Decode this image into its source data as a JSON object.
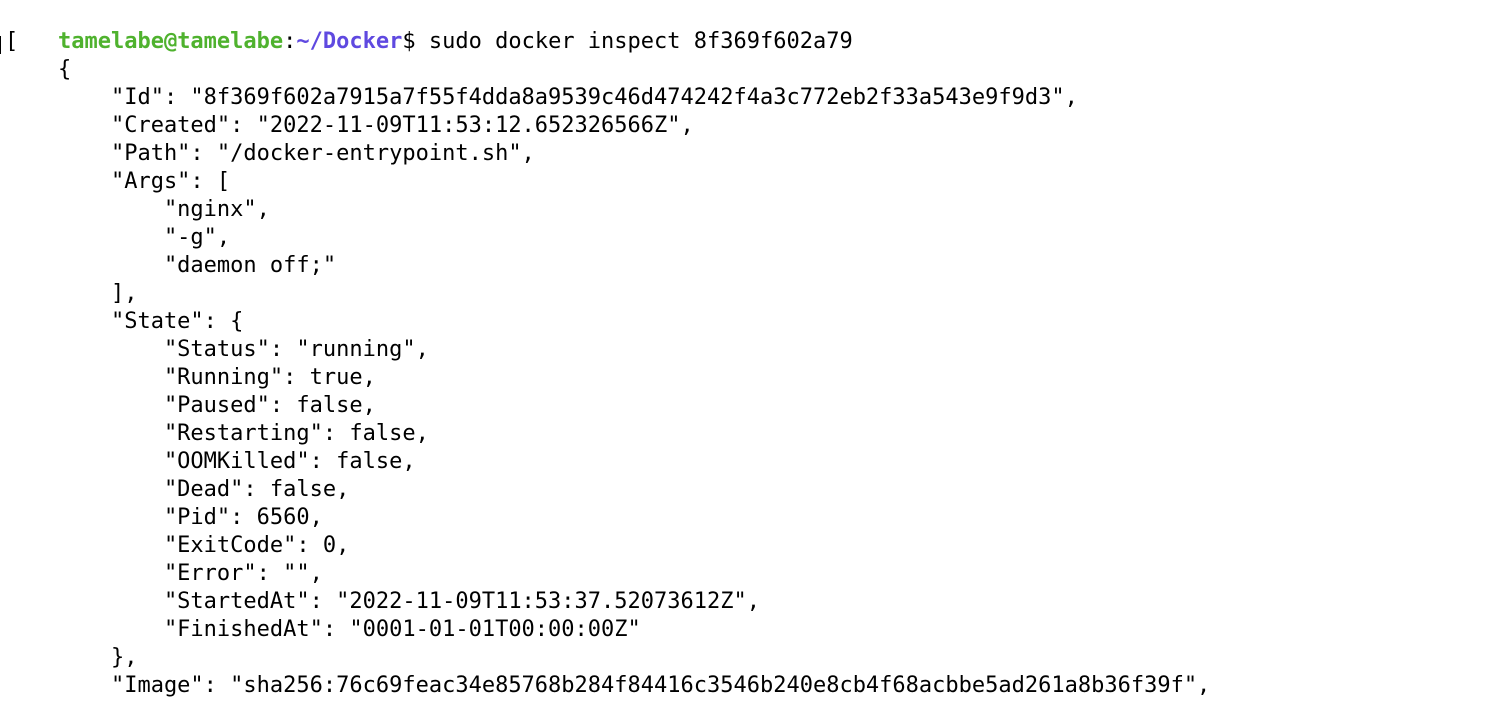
{
  "prompt": {
    "user_host": "tamelabe@tamelabe",
    "colon": ":",
    "path": "~/Docker",
    "dollar": "$",
    "command": " sudo docker inspect 8f369f602a79"
  },
  "colors": {
    "user_host": "#4fb22e",
    "path": "#5f49e0",
    "text": "#000000",
    "background": "#ffffff"
  },
  "output_lines": [
    "[",
    "    {",
    "        \"Id\": \"8f369f602a7915a7f55f4dda8a9539c46d474242f4a3c772eb2f33a543e9f9d3\",",
    "        \"Created\": \"2022-11-09T11:53:12.652326566Z\",",
    "        \"Path\": \"/docker-entrypoint.sh\",",
    "        \"Args\": [",
    "            \"nginx\",",
    "            \"-g\",",
    "            \"daemon off;\"",
    "        ],",
    "        \"State\": {",
    "            \"Status\": \"running\",",
    "            \"Running\": true,",
    "            \"Paused\": false,",
    "            \"Restarting\": false,",
    "            \"OOMKilled\": false,",
    "            \"Dead\": false,",
    "            \"Pid\": 6560,",
    "            \"ExitCode\": 0,",
    "            \"Error\": \"\",",
    "            \"StartedAt\": \"2022-11-09T11:53:37.52073612Z\",",
    "            \"FinishedAt\": \"0001-01-01T00:00:00Z\"",
    "        },",
    "        \"Image\": \"sha256:76c69feac34e85768b284f84416c3546b240e8cb4f68acbbe5ad261a8b36f39f\","
  ]
}
